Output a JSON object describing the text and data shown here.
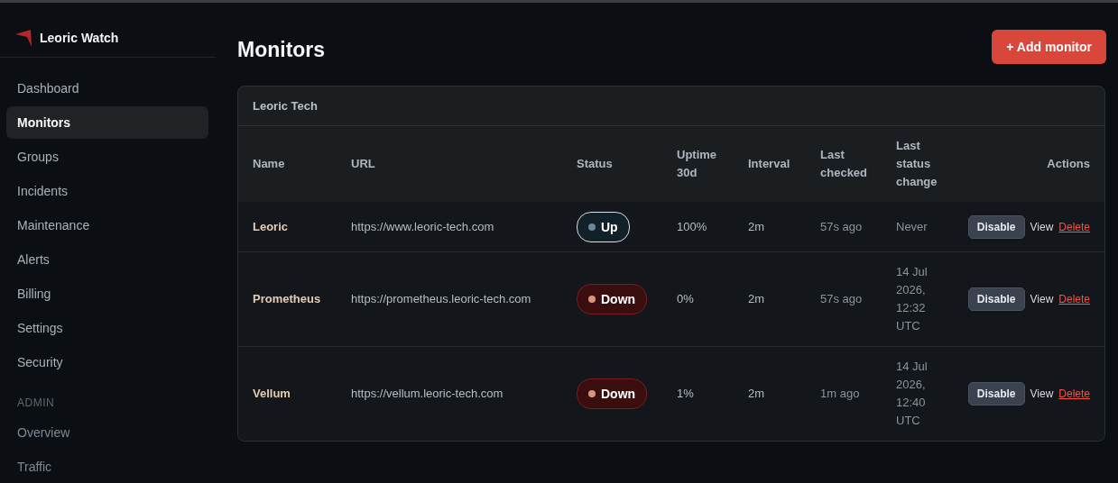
{
  "brand": {
    "name": "Leoric Watch"
  },
  "sidebar": {
    "items": [
      {
        "label": "Dashboard",
        "selected": false
      },
      {
        "label": "Monitors",
        "selected": true
      },
      {
        "label": "Groups",
        "selected": false
      },
      {
        "label": "Incidents",
        "selected": false
      },
      {
        "label": "Maintenance",
        "selected": false
      },
      {
        "label": "Alerts",
        "selected": false
      },
      {
        "label": "Billing",
        "selected": false
      },
      {
        "label": "Settings",
        "selected": false
      },
      {
        "label": "Security",
        "selected": false
      }
    ],
    "admin_heading": "ADMIN",
    "admin_items": [
      {
        "label": "Overview",
        "selected": false
      },
      {
        "label": "Traffic",
        "selected": false
      }
    ]
  },
  "page": {
    "title": "Monitors",
    "add_button": "+ Add monitor"
  },
  "group": {
    "title": "Leoric Tech",
    "columns": [
      "Name",
      "URL",
      "Status",
      "Uptime 30d",
      "Interval",
      "Last checked",
      "Last status change",
      "Actions"
    ],
    "rows": [
      {
        "name": "Leoric",
        "url": "https://www.leoric-tech.com",
        "status": {
          "label": "Up",
          "kind": "up"
        },
        "uptime": "100%",
        "interval": "2m",
        "last_checked": "57s ago",
        "last_change": "Never",
        "actions": [
          "Disable",
          "View",
          "Delete"
        ]
      },
      {
        "name": "Prometheus",
        "url": "https://prometheus.leoric-tech.com",
        "status": {
          "label": "Down",
          "kind": "down"
        },
        "uptime": "0%",
        "interval": "2m",
        "last_checked": "57s ago",
        "last_change": "14 Jul 2026, 12:32 UTC",
        "actions": [
          "Disable",
          "View",
          "Delete"
        ]
      },
      {
        "name": "Vellum",
        "url": "https://vellum.leoric-tech.com",
        "status": {
          "label": "Down",
          "kind": "down"
        },
        "uptime": "1%",
        "interval": "2m",
        "last_checked": "1m ago",
        "last_change": "14 Jul 2026, 12:40 UTC",
        "actions": [
          "Disable",
          "View",
          "Delete"
        ]
      }
    ]
  }
}
